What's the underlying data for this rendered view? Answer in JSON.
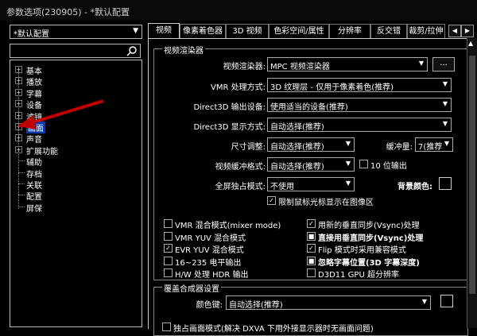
{
  "window": {
    "title": "参数选项(230905) - *默认配置"
  },
  "preset": {
    "value": "*默认配置"
  },
  "tree": {
    "items": [
      {
        "label": "基本",
        "expand": "+"
      },
      {
        "label": "播放",
        "expand": "+"
      },
      {
        "label": "字幕",
        "expand": "+"
      },
      {
        "label": "设备",
        "expand": "+"
      },
      {
        "label": "滤镜",
        "expand": "+"
      },
      {
        "label": "画面",
        "expand": "+",
        "selected": true
      },
      {
        "label": "声音",
        "expand": "+"
      },
      {
        "label": "扩展功能",
        "expand": "+"
      },
      {
        "label": "辅助"
      },
      {
        "label": "存档"
      },
      {
        "label": "关联"
      },
      {
        "label": "配置"
      },
      {
        "label": "屏保"
      }
    ]
  },
  "tabs": [
    "视频",
    "像素着色器",
    "3D 视频",
    "色彩空间/属性",
    "分辨率",
    "反交错",
    "裁剪/拉伸"
  ],
  "video_renderer_group": {
    "title": "视频渲染器",
    "renderer_label": "视频渲染器:",
    "renderer_value": "MPC 视频渲染器",
    "more_button": "...",
    "vmr_label": "VMR 处理方式:",
    "vmr_value": "3D 纹理层 - 仅用于像素着色(推荐)",
    "d3d_device_label": "Direct3D 输出设备:",
    "d3d_device_value": "使用适当的设备(推荐)",
    "d3d_display_label": "Direct3D 显示方式:",
    "d3d_display_value": "自动选择(推荐)",
    "size_label": "尺寸调整:",
    "size_value": "自动选择(推荐)",
    "buffer_label": "缓冲量:",
    "buffer_value": "7(推荐",
    "vbuf_label": "视频缓冲格式:",
    "vbuf_value": "自动选择(推荐)",
    "tenbit_label": "10 位输出",
    "fullscreen_label": "全屏独占模式:",
    "fullscreen_value": "不使用",
    "bg_label": "背景颜色:",
    "limit_mouse_label": "限制鼠标光标显示在图像区"
  },
  "checkboxes": {
    "left": [
      {
        "label": "VMR 混合模式(mixer mode)",
        "checked": false
      },
      {
        "label": "VMR YUV 混合模式",
        "checked": false
      },
      {
        "label": "EVR YUV 混合模式",
        "checked": true
      },
      {
        "label": "16~235 电平输出",
        "checked": false
      },
      {
        "label": "H/W 处理 HDR 输出",
        "checked": false
      }
    ],
    "right": [
      {
        "label": "用新的垂直同步(Vsync)处理",
        "checked": true,
        "bold": false
      },
      {
        "label": "直接用垂直同步(Vsync)处理",
        "checked": true,
        "bold": true,
        "state": "■"
      },
      {
        "label": "Flip 模式时采用兼容模式",
        "checked": true,
        "bold": false
      },
      {
        "label": "忽略字幕位置(3D 字幕深度)",
        "checked": true,
        "bold": true,
        "state": "■"
      },
      {
        "label": "D3D11 GPU 超分辨率",
        "checked": false,
        "bold": false
      }
    ]
  },
  "overlay_group": {
    "title": "覆盖合成器设置",
    "key_color_label": "颜色键:",
    "key_color_value": "自动选择(推荐)",
    "exclusive_label": "独占画面模式(解决 DXVA 下用外接显示器时无画面问题)"
  }
}
